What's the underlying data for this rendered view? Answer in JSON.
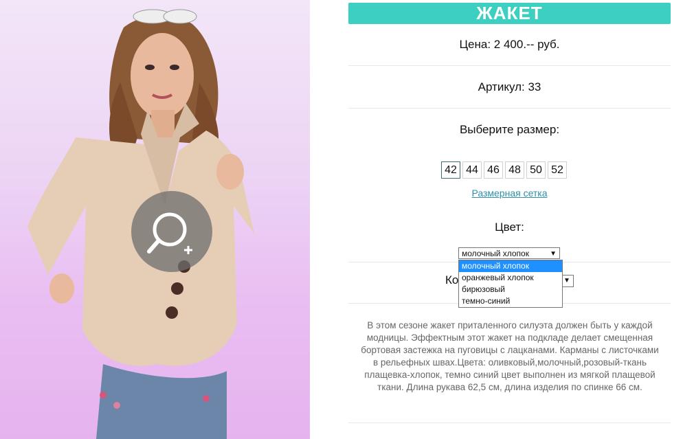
{
  "product": {
    "title": "ЖАКЕТ",
    "price_text": "Цена: 2 400.-- руб.",
    "article_text": "Артикул: 33",
    "size_prompt": "Выберите размер:",
    "sizes": [
      "42",
      "44",
      "46",
      "48",
      "50",
      "52"
    ],
    "selected_size": "42",
    "size_chart_link": "Размерная сетка",
    "color_label": "Цвет:",
    "color_selected": "молочный хлопок",
    "color_options": [
      "молочный хлопок",
      "оранжевый хлопок",
      "бирюзовый",
      "темно-синий"
    ],
    "quantity_label_partial": "Ко",
    "description": "В этом сезоне жакет приталенного силуэта должен быть у каждой модницы. Эффектным этот жакет на подкладе делает смещенная бортовая застежка на пуговицы с лацканами. Карманы с листочками в рельефных швах.Цвета: оливковый,молочный,розовый-ткань плащевка-хлопок, темно синий цвет выполнен из мягкой плащевой ткани. Длина рукава 62,5 см, длина изделия по спинке 66 см."
  },
  "icons": {
    "zoom": "magnifier-plus-icon",
    "dropdown_arrow": "▼"
  },
  "colors": {
    "title_bar": "#3ccfc2",
    "link": "#2f8fa8",
    "dropdown_highlight": "#1e90ff"
  }
}
